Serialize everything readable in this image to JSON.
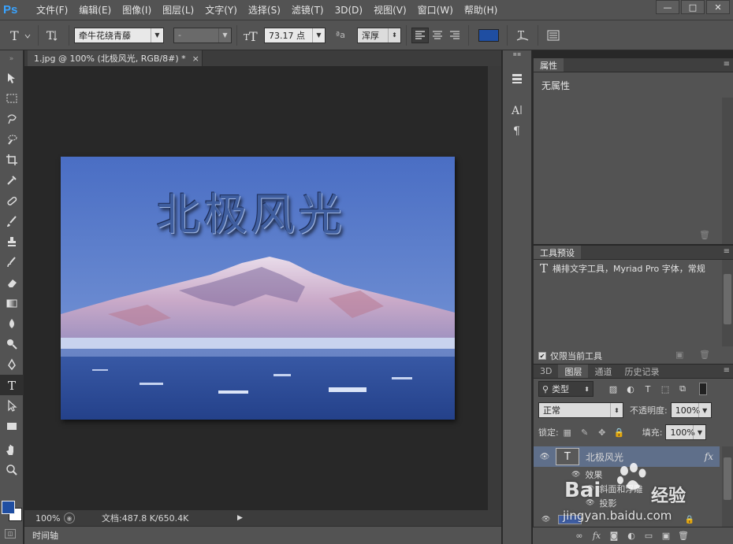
{
  "app": {
    "logo": "Ps",
    "menu": [
      "文件(F)",
      "编辑(E)",
      "图像(I)",
      "图层(L)",
      "文字(Y)",
      "选择(S)",
      "滤镜(T)",
      "3D(D)",
      "视图(V)",
      "窗口(W)",
      "帮助(H)"
    ],
    "window_buttons": [
      "—",
      "□",
      "✕"
    ]
  },
  "options": {
    "font_family": "牵牛花绕青藤",
    "font_style": "-",
    "font_size": "73.17 点",
    "aa_label": "ªa",
    "antialias": "浑厚",
    "text_color": "#1f4ea2"
  },
  "document": {
    "tab_title": "1.jpg @ 100% (北极风光, RGB/8#) *",
    "tab_close": "×",
    "title_art": "北极风光",
    "zoom": "100%",
    "doc_info": "文档:487.8 K/650.4K",
    "timeline": "时间轴"
  },
  "properties": {
    "tab": "属性",
    "message": "无属性"
  },
  "tool_presets": {
    "tab": "工具预设",
    "item": "横排文字工具，Myriad Pro 字体，常规",
    "current_only": "仅限当前工具"
  },
  "layers": {
    "tabs": [
      "3D",
      "图层",
      "通道",
      "历史记录"
    ],
    "filter_kind": "类型",
    "blend_mode": "正常",
    "opacity_label": "不透明度:",
    "opacity": "100%",
    "lock_label": "锁定:",
    "fill_label": "填充:",
    "fill": "100%",
    "layer_name": "北极风光",
    "fx": "fx",
    "effects_label": "效果",
    "effect_1": "斜面和浮雕",
    "effect_2": "投影"
  },
  "watermark": {
    "brand": "Bai",
    "brand2": "经验",
    "url": "jingyan.baidu.com"
  }
}
